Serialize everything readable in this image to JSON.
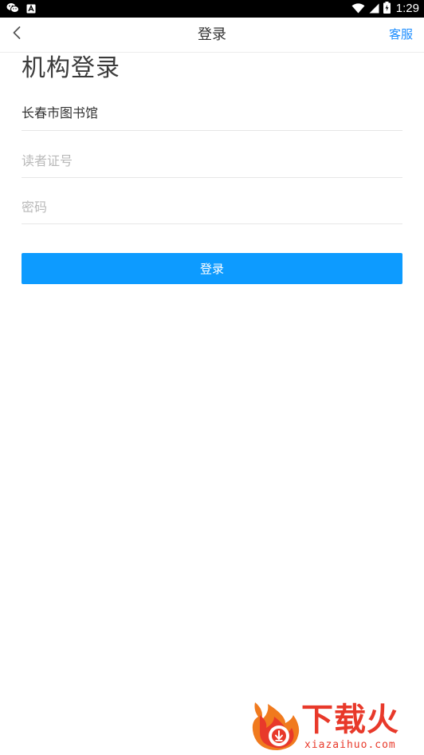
{
  "status_bar": {
    "time": "1:29",
    "icons": [
      "wechat-icon",
      "app-notification-icon",
      "wifi-icon",
      "signal-icon",
      "battery-icon"
    ]
  },
  "header": {
    "title": "登录",
    "right_link": "客服",
    "back_icon": "chevron-left-icon"
  },
  "main": {
    "page_title": "机构登录",
    "institution": "长春市图书馆",
    "card_number_placeholder": "读者证号",
    "password_placeholder": "密码",
    "login_button": "登录"
  },
  "watermark": {
    "text": "下载火",
    "url": "xiazaihuo.com"
  },
  "colors": {
    "accent": "#0d9bff",
    "link": "#1a8cff",
    "watermark": "#e8392a"
  }
}
